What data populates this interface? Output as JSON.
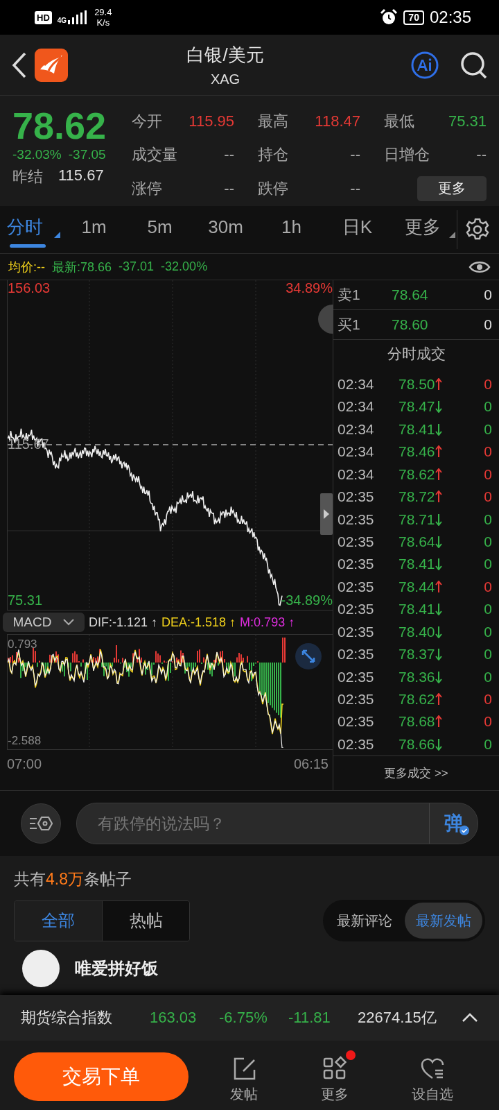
{
  "status_bar": {
    "hd_label": "HD",
    "network": "4G",
    "speed": "29.4",
    "speed_unit": "K/s",
    "battery": "70",
    "time": "02:35"
  },
  "header": {
    "title": "白银/美元",
    "code": "XAG"
  },
  "quote": {
    "price": "78.62",
    "color": "#36b24a",
    "change_pct": "-32.03%",
    "change": "-37.05",
    "prev_label": "昨结",
    "prev_value": "115.67",
    "fields": [
      {
        "label": "今开",
        "value": "115.95",
        "color": "#e53935"
      },
      {
        "label": "最高",
        "value": "118.47",
        "color": "#e53935"
      },
      {
        "label": "最低",
        "value": "75.31",
        "color": "#36b24a"
      },
      {
        "label": "成交量",
        "value": "--",
        "color": "#aaaaaa"
      },
      {
        "label": "持仓",
        "value": "--",
        "color": "#aaaaaa"
      },
      {
        "label": "日增仓",
        "value": "--",
        "color": "#aaaaaa"
      },
      {
        "label": "涨停",
        "value": "--",
        "color": "#aaaaaa"
      },
      {
        "label": "跌停",
        "value": "--",
        "color": "#aaaaaa"
      }
    ],
    "more_button": "更多"
  },
  "tabs": [
    {
      "label": "分时",
      "selected": true,
      "dropdown": true
    },
    {
      "label": "1m",
      "selected": false,
      "dropdown": false
    },
    {
      "label": "5m",
      "selected": false,
      "dropdown": false
    },
    {
      "label": "30m",
      "selected": false,
      "dropdown": false
    },
    {
      "label": "1h",
      "selected": false,
      "dropdown": false
    },
    {
      "label": "日K",
      "selected": false,
      "dropdown": false
    },
    {
      "label": "更多",
      "selected": false,
      "dropdown": true
    }
  ],
  "info_line": [
    {
      "text": "均价:--",
      "color": "#f2d21b"
    },
    {
      "text": "最新:78.66",
      "color": "#36b24a"
    },
    {
      "text": "-37.01",
      "color": "#36b24a"
    },
    {
      "text": "-32.00%",
      "color": "#36b24a"
    }
  ],
  "price_chart": {
    "top_price": "156.03",
    "top_pct": "34.89%",
    "base_price": "115.67",
    "bottom_price": "75.31",
    "bottom_pct": "-34.89%"
  },
  "macd": {
    "indicator": "MACD",
    "legend": [
      {
        "text": "DIF:-1.121 ↑",
        "color": "#d8d8d8"
      },
      {
        "text": "DEA:-1.518 ↑",
        "color": "#f2d21b"
      },
      {
        "text": "M:0.793 ↑",
        "color": "#e02ee0"
      }
    ],
    "top_label": "0.793",
    "bottom_label": "-2.588"
  },
  "time_axis": {
    "start": "07:00",
    "end": "06:15"
  },
  "order_book": [
    {
      "label": "卖1",
      "price": "78.64",
      "volume": "0"
    },
    {
      "label": "买1",
      "price": "78.60",
      "volume": "0"
    }
  ],
  "trades_title": "分时成交",
  "trades": [
    {
      "time": "02:34",
      "price": "78.50",
      "kind": "up",
      "volume": "0"
    },
    {
      "time": "02:34",
      "price": "78.47",
      "kind": "down",
      "volume": "0"
    },
    {
      "time": "02:34",
      "price": "78.41",
      "kind": "down",
      "volume": "0"
    },
    {
      "time": "02:34",
      "price": "78.46",
      "kind": "up",
      "volume": "0"
    },
    {
      "time": "02:34",
      "price": "78.62",
      "kind": "up",
      "volume": "0"
    },
    {
      "time": "02:35",
      "price": "78.72",
      "kind": "up",
      "volume": "0"
    },
    {
      "time": "02:35",
      "price": "78.71",
      "kind": "down",
      "volume": "0"
    },
    {
      "time": "02:35",
      "price": "78.64",
      "kind": "down",
      "volume": "0"
    },
    {
      "time": "02:35",
      "price": "78.41",
      "kind": "down",
      "volume": "0"
    },
    {
      "time": "02:35",
      "price": "78.44",
      "kind": "up",
      "volume": "0"
    },
    {
      "time": "02:35",
      "price": "78.41",
      "kind": "down",
      "volume": "0"
    },
    {
      "time": "02:35",
      "price": "78.40",
      "kind": "down",
      "volume": "0"
    },
    {
      "time": "02:35",
      "price": "78.37",
      "kind": "down",
      "volume": "0"
    },
    {
      "time": "02:35",
      "price": "78.36",
      "kind": "down",
      "volume": "0"
    },
    {
      "time": "02:35",
      "price": "78.62",
      "kind": "up",
      "volume": "0"
    },
    {
      "time": "02:35",
      "price": "78.68",
      "kind": "up",
      "volume": "0"
    },
    {
      "time": "02:35",
      "price": "78.66",
      "kind": "down",
      "volume": "0"
    }
  ],
  "trades_more": "更多成交 >>",
  "comment": {
    "placeholder": "有跌停的说法吗？",
    "danmaku_button": "弹"
  },
  "posts": {
    "count_before": "共有",
    "count": "4.8万",
    "count_after": "条帖子",
    "filters": [
      {
        "label": "全部",
        "selected": true
      },
      {
        "label": "热帖",
        "selected": false
      }
    ],
    "sorts": [
      {
        "label": "最新评论",
        "selected": false
      },
      {
        "label": "最新发帖",
        "selected": true
      }
    ],
    "first_post_author": "唯爱拼好饭"
  },
  "index_bar": {
    "name": "期货综合指数",
    "value": "163.03",
    "change_pct": "-6.75%",
    "change": "-11.81",
    "turnover": "22674.15亿"
  },
  "bottom_bar": {
    "trade_button": "交易下单",
    "items": [
      {
        "label": "发帖",
        "kind": "post",
        "badge": false
      },
      {
        "label": "更多",
        "kind": "more",
        "badge": true
      },
      {
        "label": "设自选",
        "kind": "watch",
        "badge": false
      }
    ]
  }
}
